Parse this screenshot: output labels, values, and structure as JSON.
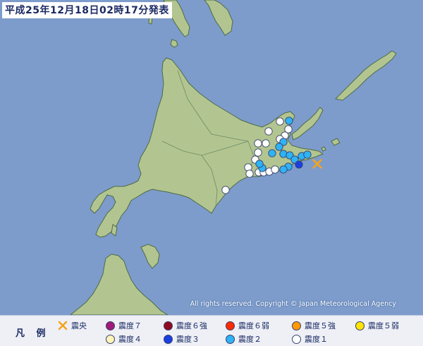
{
  "title": "平成25年12月18日02時17分発表",
  "credit": "All rights reserved. Copyright © Japan Meteorological Agency",
  "legend": {
    "title": "凡 例",
    "items": [
      {
        "key": "epicenter",
        "label": "震央",
        "type": "epicenter",
        "color": "#f7a21a"
      },
      {
        "key": "int7",
        "label": "震度７",
        "type": "dot",
        "color": "#a01a7a"
      },
      {
        "key": "int6p",
        "label": "震度６強",
        "type": "dot",
        "color": "#8f0a1e"
      },
      {
        "key": "int6m",
        "label": "震度６弱",
        "type": "dot",
        "color": "#ff2a00"
      },
      {
        "key": "int5p",
        "label": "震度５強",
        "type": "dot",
        "color": "#ff9a00"
      },
      {
        "key": "int5m",
        "label": "震度５弱",
        "type": "dot",
        "color": "#ffe500"
      },
      {
        "key": "int4",
        "label": "震度４",
        "type": "dot",
        "color": "#fff3b8"
      },
      {
        "key": "int3",
        "label": "震度３",
        "type": "dot",
        "color": "#1a3fe0"
      },
      {
        "key": "int2",
        "label": "震度２",
        "type": "dot",
        "color": "#2eb3f5"
      },
      {
        "key": "int1",
        "label": "震度１",
        "type": "dot",
        "color": "#ffffff"
      }
    ]
  },
  "colors": {
    "sea": "#7d9ccb",
    "land": "#b2c590",
    "border": "#5a7a5a",
    "epicenter": "#f7a21a"
  },
  "observations": {
    "intensity_3": [
      [
        424,
        233
      ]
    ],
    "intensity_2": [
      [
        410,
        171
      ],
      [
        402,
        201
      ],
      [
        396,
        208
      ],
      [
        386,
        217
      ],
      [
        402,
        218
      ],
      [
        411,
        220
      ],
      [
        418,
        226
      ],
      [
        428,
        221
      ],
      [
        436,
        219
      ],
      [
        409,
        236
      ],
      [
        402,
        240
      ],
      [
        372,
        238
      ],
      [
        368,
        232
      ]
    ],
    "intensity_1": [
      [
        409,
        183
      ],
      [
        404,
        192
      ],
      [
        397,
        197
      ],
      [
        381,
        186
      ],
      [
        377,
        203
      ],
      [
        366,
        203
      ],
      [
        366,
        216
      ],
      [
        362,
        226
      ],
      [
        352,
        237
      ],
      [
        354,
        246
      ],
      [
        367,
        244
      ],
      [
        374,
        244
      ],
      [
        382,
        243
      ],
      [
        390,
        240
      ],
      [
        320,
        269
      ],
      [
        397,
        172
      ]
    ]
  },
  "epicenter_pos": [
    450,
    232
  ]
}
